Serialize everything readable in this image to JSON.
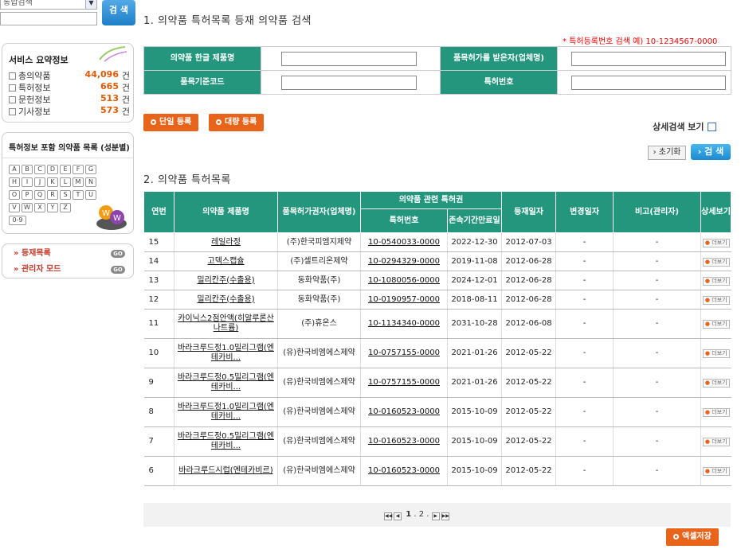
{
  "sidebar": {
    "search_select_value": "통합검색",
    "search_button": "검 색",
    "summary_title": "서비스 요약정보",
    "summary": [
      {
        "label": "총의약품",
        "count": "44,096",
        "unit": "건"
      },
      {
        "label": "특허정보",
        "count": "665",
        "unit": "건"
      },
      {
        "label": "문헌정보",
        "count": "513",
        "unit": "건"
      },
      {
        "label": "기사정보",
        "count": "573",
        "unit": "건"
      }
    ],
    "index_title": "특허정보 포함 의약품 목록 (성분별)",
    "letters": [
      "A",
      "B",
      "C",
      "D",
      "E",
      "F",
      "G",
      "H",
      "I",
      "J",
      "K",
      "L",
      "M",
      "N",
      "O",
      "P",
      "Q",
      "R",
      "S",
      "T",
      "U",
      "V",
      "W",
      "X",
      "Y",
      "Z",
      "0-9"
    ],
    "menu": [
      {
        "label": "»  등재목록",
        "go": "GO"
      },
      {
        "label": "»  관리자 모드",
        "go": "GO"
      }
    ]
  },
  "section1": {
    "title": "1. 의약품 특허목록 등재 의약품 검색",
    "hint": "* 특허등록번호 검색 예) 10-1234567-0000",
    "fields": {
      "product_name": "의약품 한글 제품명",
      "permit_holder": "품목허가를 받은자(업체명)",
      "standard_code": "품목기준코드",
      "patent_no": "특허번호"
    },
    "btn_single": "단일 등록",
    "btn_bulk": "대량 등록",
    "detail_label": "상세검색 보기",
    "btn_reset": "› 초기화",
    "btn_search": "› 검 색"
  },
  "section2": {
    "title": "2. 의약품 특허목록",
    "headers": {
      "no": "연번",
      "name": "의약품 제품명",
      "holder": "품목허가권자(업체명)",
      "patent_group": "의약품 관련 특허권",
      "patent_no": "특허번호",
      "expiry": "존속기간만료일",
      "reg_date": "등재일자",
      "change_date": "변경일자",
      "note": "비고(관리자)",
      "detail": "상세보기"
    },
    "view_label": "더보기",
    "rows": [
      {
        "no": "15",
        "name": "레일라정",
        "holder": "(주)한국피엠지제약",
        "patent": "10-0540033-0000",
        "expiry": "2022-12-30",
        "reg": "2012-07-03",
        "change": "-",
        "note": "-"
      },
      {
        "no": "14",
        "name": "고덱스캡슐",
        "holder": "(주)셀트리온제약",
        "patent": "10-0294329-0000",
        "expiry": "2019-11-08",
        "reg": "2012-06-28",
        "change": "-",
        "note": "-"
      },
      {
        "no": "13",
        "name": "밀리칸주(수출용)",
        "holder": "동화약품(주)",
        "patent": "10-1080056-0000",
        "expiry": "2024-12-01",
        "reg": "2012-06-28",
        "change": "-",
        "note": "-"
      },
      {
        "no": "12",
        "name": "밀리칸주(수출용)",
        "holder": "동화약품(주)",
        "patent": "10-0190957-0000",
        "expiry": "2018-08-11",
        "reg": "2012-06-28",
        "change": "-",
        "note": "-"
      },
      {
        "no": "11",
        "name": "카이닉스2점안액(히알루론산나트륨)",
        "holder": "(주)휴온스",
        "patent": "10-1134340-0000",
        "expiry": "2031-10-28",
        "reg": "2012-06-08",
        "change": "-",
        "note": "-"
      },
      {
        "no": "10",
        "name": "바라크루드정1.0밀리그램(엔테카비...",
        "holder": "(유)한국비엠에스제약",
        "patent": "10-0757155-0000",
        "expiry": "2021-01-26",
        "reg": "2012-05-22",
        "change": "-",
        "note": "-"
      },
      {
        "no": "9",
        "name": "바라크루드정0.5밀리그램(엔테카비...",
        "holder": "(유)한국비엠에스제약",
        "patent": "10-0757155-0000",
        "expiry": "2021-01-26",
        "reg": "2012-05-22",
        "change": "-",
        "note": "-"
      },
      {
        "no": "8",
        "name": "바라크루드정1.0밀리그램(엔테카비...",
        "holder": "(유)한국비엠에스제약",
        "patent": "10-0160523-0000",
        "expiry": "2015-10-09",
        "reg": "2012-05-22",
        "change": "-",
        "note": "-"
      },
      {
        "no": "7",
        "name": "바라크루드정0.5밀리그램(엔테카비...",
        "holder": "(유)한국비엠에스제약",
        "patent": "10-0160523-0000",
        "expiry": "2015-10-09",
        "reg": "2012-05-22",
        "change": "-",
        "note": "-"
      },
      {
        "no": "6",
        "name": "바라크루드시럽(엔테카비르)",
        "holder": "(유)한국비엠에스제약",
        "patent": "10-0160523-0000",
        "expiry": "2015-10-09",
        "reg": "2012-05-22",
        "change": "-",
        "note": "-"
      }
    ],
    "pages": [
      "1",
      "2"
    ],
    "current_page": "1",
    "btn_excel": "엑셀저장"
  },
  "colors": {
    "header_green": "#23967d",
    "accent_orange": "#e8641b",
    "count_orange": "#e05a00"
  }
}
